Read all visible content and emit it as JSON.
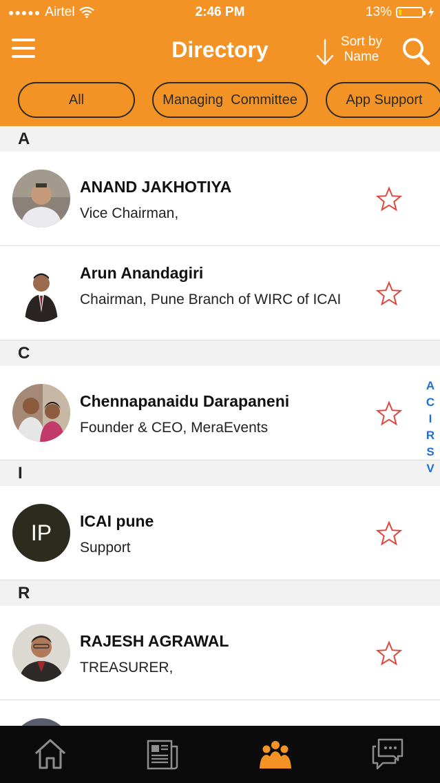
{
  "status_bar": {
    "carrier": "Airtel",
    "time": "2:46 PM",
    "battery": "13%",
    "battery_level": 0.13
  },
  "header": {
    "title": "Directory",
    "sort_label_line1": "Sort by",
    "sort_label_line2": "Name"
  },
  "filters": [
    {
      "label": "All",
      "active": true
    },
    {
      "label": "Managing  Committee",
      "active": false
    },
    {
      "label": "App Support",
      "active": false
    }
  ],
  "sections": [
    {
      "letter": "A",
      "contacts": [
        {
          "name": "ANAND JAKHOTIYA",
          "role": "Vice Chairman,",
          "avatar": "photo"
        },
        {
          "name": "Arun Anandagiri",
          "role": "Chairman, Pune Branch of WIRC of ICAI",
          "avatar": "photo"
        }
      ]
    },
    {
      "letter": "C",
      "contacts": [
        {
          "name": "Chennapanaidu Darapaneni",
          "role": "Founder & CEO, MeraEvents",
          "avatar": "photo"
        }
      ]
    },
    {
      "letter": "I",
      "contacts": [
        {
          "name": "ICAI pune",
          "role": "Support",
          "avatar": "initials",
          "initials": "IP"
        }
      ]
    },
    {
      "letter": "R",
      "contacts": [
        {
          "name": "RAJESH AGRAWAL",
          "role": "TREASURER,",
          "avatar": "photo"
        }
      ]
    }
  ],
  "index_letters": [
    "A",
    "C",
    "I",
    "R",
    "S",
    "V"
  ],
  "tabbar": {
    "items": [
      {
        "icon": "home-icon",
        "active": false
      },
      {
        "icon": "newspaper-icon",
        "active": false
      },
      {
        "icon": "people-icon",
        "active": true
      },
      {
        "icon": "chat-icon",
        "active": false
      }
    ]
  },
  "colors": {
    "accent": "#f39325",
    "dark": "#2d2a1e",
    "star": "#e0473c",
    "index": "#1e6fd1"
  }
}
